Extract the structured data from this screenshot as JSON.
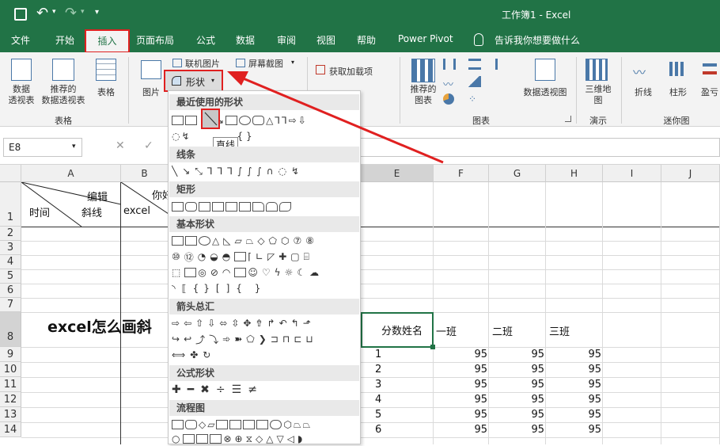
{
  "window": {
    "title": "工作簿1 - Excel"
  },
  "tabs": [
    "文件",
    "开始",
    "插入",
    "页面布局",
    "公式",
    "数据",
    "审阅",
    "视图",
    "帮助",
    "Power Pivot"
  ],
  "tell_me": "告诉我你想要做什么",
  "ribbon": {
    "pivot_table": "数据\n透视表",
    "recommended_pivot": "推荐的\n数据透视表",
    "table": "表格",
    "group_tables": "表格",
    "pictures": "图片",
    "online_pictures": "联机图片",
    "screenshot": "屏幕截图",
    "shapes": "形状",
    "get_addins": "获取加载项",
    "recommended_charts": "推荐的\n图表",
    "pivot_chart": "数据透视图",
    "group_charts": "图表",
    "map3d": "三维地\n图",
    "group_tours": "演示",
    "spark_line": "折线",
    "spark_column": "柱形",
    "spark_winloss": "盈亏",
    "group_sparklines": "迷你图"
  },
  "namebox": "E8",
  "columns": [
    "A",
    "B",
    "E",
    "F",
    "G",
    "H",
    "I",
    "J"
  ],
  "rows": [
    "1",
    "2",
    "3",
    "4",
    "5",
    "6",
    "7",
    "8",
    "9",
    "10",
    "11",
    "12",
    "13",
    "14"
  ],
  "cells": {
    "a1_edit": "编辑",
    "a1_time": "时间",
    "a1_diag": "斜线",
    "b1_you": "你好",
    "b1_excel": "excel",
    "big_title": "excel怎么画斜",
    "e8": "分数姓名",
    "f8": "一班",
    "g8": "二班",
    "h8": "三班",
    "e_col": [
      "1",
      "2",
      "3",
      "4",
      "5",
      "6"
    ],
    "value": "95"
  },
  "shapes_menu": {
    "recent": "最近使用的形状",
    "lines": "线条",
    "rectangles": "矩形",
    "basic": "基本形状",
    "block_arrows": "箭头总汇",
    "equation": "公式形状",
    "flowchart": "流程图",
    "tooltip": "直线",
    "recent_row2_text": "{ }",
    "basic_row7_text": "{ }"
  }
}
